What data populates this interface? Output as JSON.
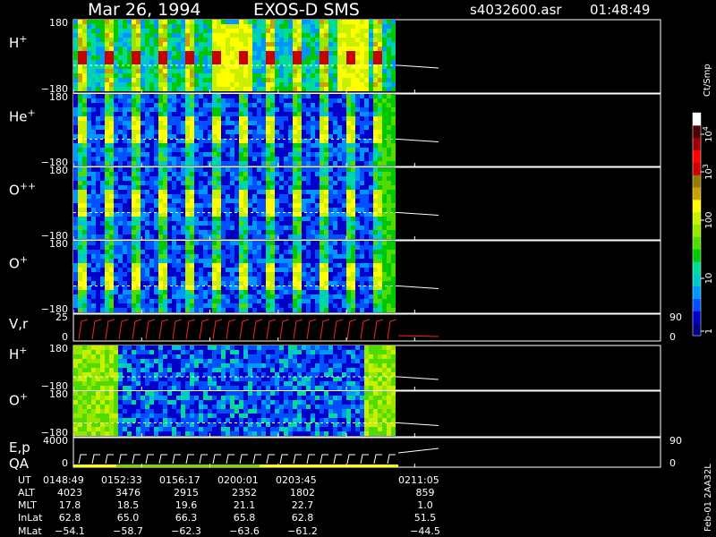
{
  "header": {
    "date": "Mar 26, 1994",
    "instrument": "EXOS-D SMS",
    "filename": "s4032600.asr",
    "time": "01:48:49"
  },
  "colorbar": {
    "unit_label": "Ct/Smp",
    "tick_labels": [
      "1",
      "10",
      "100",
      "10",
      "10"
    ],
    "tick_exponents": [
      "",
      "",
      "",
      "3",
      "4"
    ],
    "colors": [
      "#000080",
      "#0000c8",
      "#0050ff",
      "#0096ff",
      "#00c8c8",
      "#00dc96",
      "#00c800",
      "#50dc00",
      "#96e600",
      "#c8f000",
      "#ffff00",
      "#c8a000",
      "#967800",
      "#c80000",
      "#ff0000",
      "#a00000",
      "#500000",
      "#ffffff"
    ]
  },
  "side_label": "Feb-01 2AA32L",
  "footer": {
    "row_labels": [
      "UT",
      "ALT",
      "MLT",
      "InLat",
      "MLat"
    ],
    "columns": [
      [
        "0148:49",
        "4023",
        "17.8",
        "62.8",
        "−54.1"
      ],
      [
        "0152:33",
        "3476",
        "18.5",
        "65.0",
        "−58.7"
      ],
      [
        "0156:17",
        "2915",
        "19.6",
        "66.3",
        "−62.3"
      ],
      [
        "0200:01",
        "2352",
        "21.1",
        "65.8",
        "−63.6"
      ],
      [
        "0203:45",
        "1802",
        "22.7",
        "62.8",
        "−61.2"
      ],
      [
        "0211:05",
        "859",
        "1.0",
        "51.5",
        "−44.5"
      ]
    ]
  },
  "chart_data": {
    "type": "heatmap",
    "panels": [
      {
        "id": "h-plus",
        "label": "H",
        "superscript": "+",
        "ymax_label": "180",
        "ymin_label": "−180",
        "style": "h"
      },
      {
        "id": "he-plus",
        "label": "He",
        "superscript": "+",
        "ymax_label": "180",
        "ymin_label": "−180",
        "style": "he"
      },
      {
        "id": "o-plusplus",
        "label": "O",
        "superscript": "++",
        "ymax_label": "180",
        "ymin_label": "−180",
        "style": "opp"
      },
      {
        "id": "o-plus",
        "label": "O",
        "superscript": "+",
        "ymax_label": "180",
        "ymin_label": "−180",
        "style": "op"
      },
      {
        "id": "vr",
        "label": "V,r",
        "superscript": "",
        "ymax_label": "25",
        "ymin_label": "0",
        "right_top": "90",
        "right_bottom": "0",
        "style": "vr"
      },
      {
        "id": "h-plus-2",
        "label": "H",
        "superscript": "+",
        "ymax_label": "180",
        "ymin_label": "−180",
        "style": "h2"
      },
      {
        "id": "o-plus-2",
        "label": "O",
        "superscript": "+",
        "ymax_label": "180",
        "ymin_label": "−180",
        "style": "o2"
      },
      {
        "id": "ep",
        "label": "E,p",
        "label2": "QA",
        "superscript": "",
        "ymax_label": "4000",
        "ymin_label": "0",
        "right_top": "90",
        "right_bottom": "0",
        "style": "ep"
      }
    ],
    "x_ticks": [
      "0148:49",
      "0152:33",
      "0156:17",
      "0200:01",
      "0203:45",
      "0211:05"
    ],
    "data_coverage_fraction": 0.72
  }
}
